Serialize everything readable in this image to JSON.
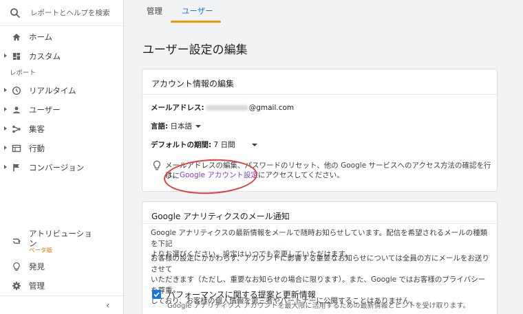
{
  "sidebar": {
    "search_placeholder": "レポートとヘルプを検索",
    "items_top": [
      {
        "label": "ホーム",
        "icon": "home-icon"
      },
      {
        "label": "カスタム",
        "icon": "dashboard-icon"
      }
    ],
    "section_label": "レポート",
    "reports": [
      {
        "label": "リアルタイム",
        "icon": "clock-icon"
      },
      {
        "label": "ユーザー",
        "icon": "person-icon"
      },
      {
        "label": "集客",
        "icon": "acquisition-icon"
      },
      {
        "label": "行動",
        "icon": "behavior-icon"
      },
      {
        "label": "コンバージョン",
        "icon": "flag-icon"
      }
    ],
    "attribution": {
      "line1": "アトリビューショ",
      "line2": "ン",
      "badge": "ベータ版"
    },
    "discover": "発見",
    "admin": "管理",
    "collapse_icon": "‹"
  },
  "tabs": [
    {
      "label": "管理",
      "active": false
    },
    {
      "label": "ユーザー",
      "active": true
    }
  ],
  "page_title": "ユーザー設定の編集",
  "account_card": {
    "title": "アカウント情報の編集",
    "email_label": "メールアドレス:",
    "email_domain": "@gmail.com",
    "language_label": "言語:",
    "language_value": "日本語",
    "period_label": "デフォルトの期間:",
    "period_value": "7 日間",
    "tip_line1": "メールアドレスの編集、パスワードのリセット、他の Google サービスへのアクセス方法の確認を行うに",
    "tip_prefix": "は、",
    "tip_link": "Google アカウント設定",
    "tip_suffix": "にアクセスしてください。"
  },
  "email_card": {
    "title": "Google アナリティクスのメール通知",
    "para1_line1": "Google アナリティクスの最新情報をメールで随時お知らせしています。配信を希望されるメールの種類を下記",
    "para1_line2": "よりお選びください。設定はいつでも変更していただけます。",
    "para2_line1": "お客様の設定にかかわらず、アカウントに影響する重要なお知らせについては全員の方にメールをお送りさせて",
    "para2_line2": "いただきます（ただし、重要なお知らせの場合に限ります）。また、Google ではお客様のプライバシーを尊重",
    "para2_line3": "しており、お客様の個人情報を第三者やパートナーに公開することはありません。",
    "option_title": "パフォーマンスに関する提案と更新情報",
    "option_sub": "Google アナリティクス アカウントを最大限に活用するための最新情報とヒントを受け取ります。",
    "option_checked": true
  },
  "colors": {
    "accent": "#1a73e8",
    "tab_underline": "#f29900",
    "link": "#7b3fcf",
    "annotation": "#e53935",
    "beta": "#e37400"
  }
}
